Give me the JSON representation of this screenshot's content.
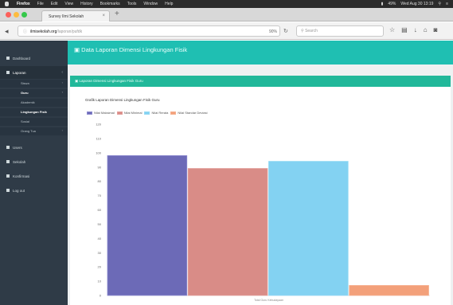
{
  "menubar": {
    "app": "Firefox",
    "items": [
      "File",
      "Edit",
      "View",
      "History",
      "Bookmarks",
      "Tools",
      "Window",
      "Help"
    ],
    "status_right": "49%",
    "clock": "Wed Aug 30 13:19"
  },
  "browser": {
    "tab_title": "Survey Ilmi Sekolah",
    "url_host": "ilmisekolah.org",
    "url_path": "/laporan/pufdk",
    "zoom": "90%",
    "search_placeholder": "Search"
  },
  "sidebar": {
    "items": [
      {
        "label": "Dashboard"
      },
      {
        "label": "Laporan"
      },
      {
        "label": "Users"
      },
      {
        "label": "Sekolah"
      },
      {
        "label": "Konfirmasi"
      },
      {
        "label": "Log out"
      }
    ],
    "submenu": [
      {
        "label": "Siswa"
      },
      {
        "label": "Guru"
      },
      {
        "label": "Akademik"
      },
      {
        "label": "Lingkungan Fisik"
      },
      {
        "label": "Sosial"
      },
      {
        "label": "Orang Tua"
      }
    ]
  },
  "page": {
    "header_title": "Data Laporan Dimensi Lingkungan Fisik",
    "box_title": "Laporan Dimensi Lingkungan Fisik Guru"
  },
  "chart_data": {
    "type": "bar",
    "title": "Grafik Laporan Dimensi Lingkungan Fisik Guru",
    "xlabel": "Total Guru Kebudayaan",
    "ylabel": "",
    "ylim": [
      0,
      120
    ],
    "y_ticks": [
      0,
      10,
      20,
      30,
      40,
      50,
      60,
      70,
      80,
      90,
      100,
      110,
      120
    ],
    "grid": false,
    "legend_position": "top-left",
    "categories": [
      ""
    ],
    "series": [
      {
        "name": "Nilai Maksimal",
        "values": [
          98
        ],
        "color": "#6c6ab7",
        "border": "#8b89cf"
      },
      {
        "name": "Nilai Minimal",
        "values": [
          89
        ],
        "color": "#d98c87",
        "border": "#e39e9a"
      },
      {
        "name": "Nilai Rerata",
        "values": [
          94
        ],
        "color": "#83d2f2",
        "border": "#93d9f4"
      },
      {
        "name": "Nilai Standar Deviasi",
        "values": [
          7
        ],
        "color": "#f3a07a",
        "border": "#f5b08f"
      }
    ]
  }
}
